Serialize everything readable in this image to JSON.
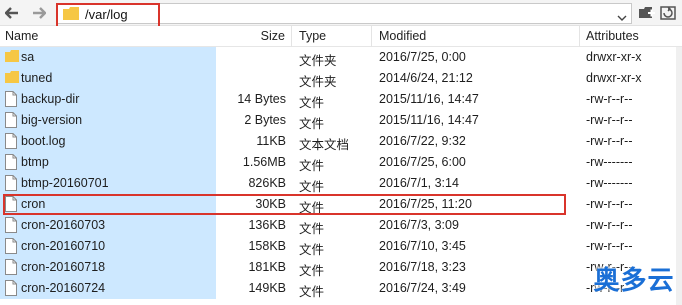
{
  "toolbar": {
    "path": "/var/log",
    "back_icon": "back-arrow-icon",
    "forward_icon": "forward-arrow-icon"
  },
  "columns": {
    "name": "Name",
    "size": "Size",
    "type": "Type",
    "modified": "Modified",
    "attributes": "Attributes"
  },
  "rows": [
    {
      "icon": "folder",
      "name": "sa",
      "size": "",
      "type": "文件夹",
      "modified": "2016/7/25, 0:00",
      "attributes": "drwxr-xr-x"
    },
    {
      "icon": "folder",
      "name": "tuned",
      "size": "",
      "type": "文件夹",
      "modified": "2014/6/24, 21:12",
      "attributes": "drwxr-xr-x"
    },
    {
      "icon": "file",
      "name": "backup-dir",
      "size": "14 Bytes",
      "type": "文件",
      "modified": "2015/11/16, 14:47",
      "attributes": "-rw-r--r--"
    },
    {
      "icon": "file",
      "name": "big-version",
      "size": "2 Bytes",
      "type": "文件",
      "modified": "2015/11/16, 14:47",
      "attributes": "-rw-r--r--"
    },
    {
      "icon": "file",
      "name": "boot.log",
      "size": "11KB",
      "type": "文本文档",
      "modified": "2016/7/22, 9:32",
      "attributes": "-rw-r--r--"
    },
    {
      "icon": "file",
      "name": "btmp",
      "size": "1.56MB",
      "type": "文件",
      "modified": "2016/7/25, 6:00",
      "attributes": "-rw-------"
    },
    {
      "icon": "file",
      "name": "btmp-20160701",
      "size": "826KB",
      "type": "文件",
      "modified": "2016/7/1, 3:14",
      "attributes": "-rw-------"
    },
    {
      "icon": "file",
      "name": "cron",
      "size": "30KB",
      "type": "文件",
      "modified": "2016/7/25, 11:20",
      "attributes": "-rw-r--r--"
    },
    {
      "icon": "file",
      "name": "cron-20160703",
      "size": "136KB",
      "type": "文件",
      "modified": "2016/7/3, 3:09",
      "attributes": "-rw-r--r--"
    },
    {
      "icon": "file",
      "name": "cron-20160710",
      "size": "158KB",
      "type": "文件",
      "modified": "2016/7/10, 3:45",
      "attributes": "-rw-r--r--"
    },
    {
      "icon": "file",
      "name": "cron-20160718",
      "size": "181KB",
      "type": "文件",
      "modified": "2016/7/18, 3:23",
      "attributes": "-rw-r--r--"
    },
    {
      "icon": "file",
      "name": "cron-20160724",
      "size": "149KB",
      "type": "文件",
      "modified": "2016/7/24, 3:49",
      "attributes": "-rw-r--r--"
    }
  ],
  "watermark": "奥多云",
  "colors": {
    "name_column_bg": "#cde8ff",
    "highlight_border": "#d9342b",
    "folder": "#f6c744",
    "watermark": "#1a6fd6"
  }
}
